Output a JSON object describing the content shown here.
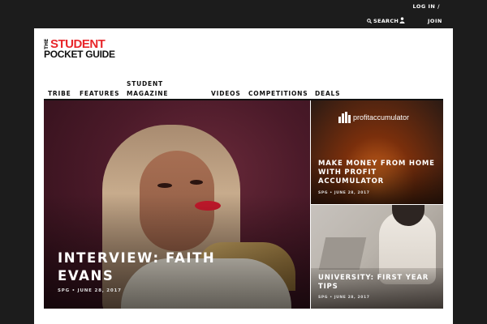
{
  "topbar": {
    "login": "LOG IN /",
    "search": "SEARCH",
    "join": "JOIN"
  },
  "logo": {
    "the": "THE",
    "line1": "STUDENT",
    "line2": "POCKET GUIDE"
  },
  "nav": {
    "items": [
      {
        "label": "TRIBE"
      },
      {
        "label": "FEATURES"
      },
      {
        "label": "STUDENT MAGAZINE"
      },
      {
        "label": "VIDEOS"
      },
      {
        "label": "COMPETITIONS"
      },
      {
        "label": "DEALS"
      }
    ]
  },
  "hero": {
    "title": "INTERVIEW: FAITH EVANS",
    "meta": "SPG • JUNE 28, 2017"
  },
  "cards": [
    {
      "brand": "profitaccumulator",
      "title": "MAKE MONEY FROM HOME WITH PROFIT ACCUMULATOR",
      "meta": "SPG • JUNE 28, 2017"
    },
    {
      "title": "UNIVERSITY: FIRST YEAR TIPS",
      "meta": "SPG • JUNE 28, 2017"
    }
  ]
}
